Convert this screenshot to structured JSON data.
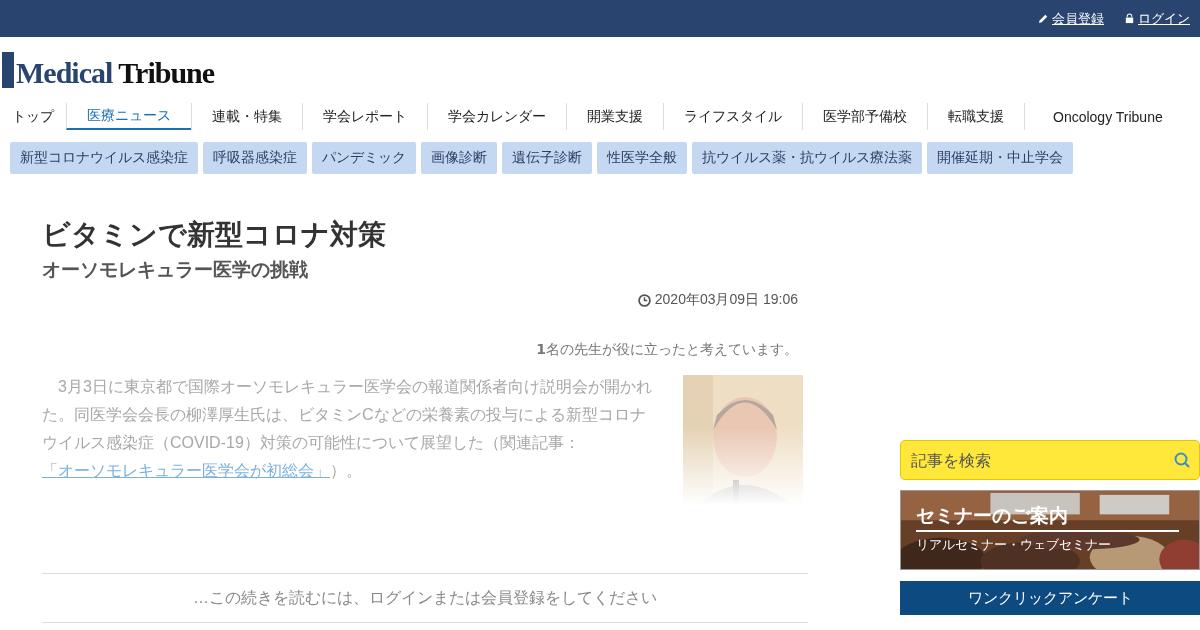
{
  "top_bar": {
    "links": [
      {
        "kind": "pencil",
        "label": "会員登録"
      },
      {
        "kind": "lock",
        "label": "ログイン"
      }
    ]
  },
  "logo": {
    "first": "Medical",
    "second": "Tribune"
  },
  "nav": [
    {
      "label": "トップ",
      "selected": false
    },
    {
      "label": "医療ニュース",
      "selected": true
    },
    {
      "label": "連載・特集",
      "selected": false
    },
    {
      "label": "学会レポート",
      "selected": false
    },
    {
      "label": "学会カレンダー",
      "selected": false
    },
    {
      "label": "開業支援",
      "selected": false
    },
    {
      "label": "ライフスタイル",
      "selected": false
    },
    {
      "label": "医学部予備校",
      "selected": false
    },
    {
      "label": "転職支援",
      "selected": false
    },
    {
      "label": "Oncology Tribune",
      "selected": false
    }
  ],
  "tags": [
    "新型コロナウイルス感染症",
    "呼吸器感染症",
    "パンデミック",
    "画像診断",
    "遺伝子診断",
    "性医学全般",
    "抗ウイルス薬・抗ウイルス療法薬",
    "開催延期・中止学会"
  ],
  "article": {
    "title": "ビタミンで新型コロナ対策",
    "subtitle": "オーソモレキュラー医学の挑戦",
    "date": "2020年03月09日 19:06",
    "helpful": "**1**名の先生が役に立ったと考えています。",
    "body": "3月3日に東京都で国際オーソモレキュラー医学会の報道関係者向け説明会が開かれた。同医学会会長の柳澤厚生氏は、ビタミンCなどの栄養素の投与による新型コロナウイルス感染症（COVID-19）対策の可能性について展望した（関連記事：",
    "link": "「オーソモレキュラー医学会が初総会」",
    "body_end": "）。",
    "paywall": "…この続きを読むには、ログインまたは会員登録をしてください"
  },
  "sidebar": {
    "search": {
      "placeholder": "記事を検索"
    },
    "seminar": {
      "title": "セミナーのご案内",
      "subtitle": "リアルセミナー・ウェブセミナー"
    },
    "survey": {
      "title": "ワンクリックアンケート"
    }
  }
}
